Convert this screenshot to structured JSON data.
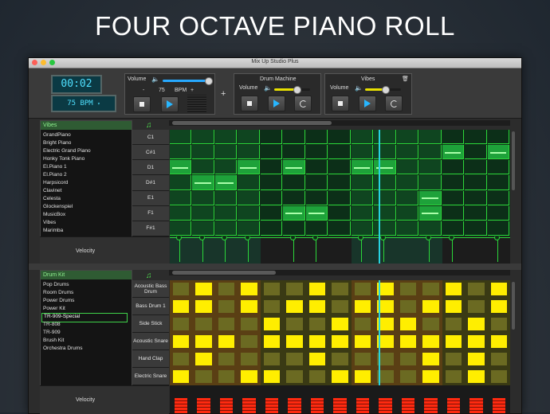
{
  "headline": "FOUR OCTAVE PIANO ROLL",
  "window": {
    "title": "Mix Up Studio Plus"
  },
  "transport": {
    "time": "00:02",
    "tempo": "75 BPM",
    "volume_label": "Volume",
    "volume_level": 0.95,
    "bpm_value": "75",
    "bpm_unit": "BPM",
    "minus": "-",
    "plus": "+"
  },
  "add_track": "+",
  "tracks": [
    {
      "name": "Drum Machine",
      "volume_label": "Volume",
      "volume_level": 0.62
    },
    {
      "name": "Vibes",
      "volume_label": "Volume",
      "volume_level": 0.55
    }
  ],
  "piano": {
    "instrument": "Vibes",
    "instruments": [
      "GrandPiano",
      "Bright Piano",
      "Electric Grand Piano",
      "Honky Tonk Piano",
      "El.Piano 1",
      "El.Piano 2",
      "Harpsicord",
      "Clavinet",
      "Celesta",
      "Glockenspiel",
      "MusicBox",
      "Vibes",
      "Marimba"
    ],
    "notes": [
      "C1",
      "C#1",
      "D1",
      "D#1",
      "E1",
      "F1",
      "F#1"
    ],
    "velocity_label": "Velocity",
    "grid_cells": [
      [
        0,
        0,
        0,
        0,
        0,
        0,
        0,
        0,
        0,
        0,
        0,
        0,
        0,
        0,
        0
      ],
      [
        0,
        0,
        0,
        0,
        0,
        0,
        0,
        0,
        0,
        0,
        0,
        0,
        1,
        0,
        1
      ],
      [
        1,
        0,
        0,
        1,
        0,
        1,
        0,
        0,
        1,
        1,
        0,
        0,
        0,
        0,
        0
      ],
      [
        0,
        1,
        1,
        0,
        0,
        0,
        0,
        0,
        0,
        0,
        0,
        0,
        0,
        0,
        0
      ],
      [
        0,
        0,
        0,
        0,
        0,
        0,
        0,
        0,
        0,
        0,
        0,
        1,
        0,
        0,
        0
      ],
      [
        0,
        0,
        0,
        0,
        0,
        1,
        1,
        0,
        0,
        0,
        0,
        1,
        0,
        0,
        0
      ],
      [
        0,
        0,
        0,
        0,
        0,
        0,
        0,
        0,
        0,
        0,
        0,
        0,
        0,
        0,
        0
      ]
    ],
    "playhead_step": 9.2
  },
  "drums": {
    "kit": "Drum Kit",
    "kits": [
      "Pop Drums",
      "Room Drums",
      "Power Drums",
      "Power Kit",
      "TR-909-Special",
      "TR-808",
      "TR-909",
      "Brush Kit",
      "Orchestra Drums"
    ],
    "selected": "TR-909-Special",
    "voices": [
      "Acoustic Bass Drum",
      "Bass Drum 1",
      "Side Stick",
      "Acoustic Snare",
      "Hand Clap",
      "Electric Snare"
    ],
    "velocity_label": "Velocity",
    "grid_cells": [
      [
        0,
        1,
        0,
        1,
        0,
        0,
        1,
        0,
        0,
        1,
        0,
        0,
        1,
        0,
        1
      ],
      [
        1,
        1,
        0,
        1,
        0,
        1,
        1,
        0,
        1,
        1,
        0,
        1,
        1,
        0,
        1
      ],
      [
        0,
        0,
        0,
        0,
        1,
        0,
        0,
        1,
        0,
        1,
        1,
        0,
        0,
        1,
        0
      ],
      [
        1,
        1,
        1,
        0,
        1,
        1,
        1,
        1,
        1,
        1,
        1,
        1,
        1,
        1,
        1
      ],
      [
        0,
        1,
        0,
        0,
        0,
        0,
        1,
        0,
        0,
        0,
        0,
        1,
        0,
        1,
        0
      ],
      [
        1,
        0,
        0,
        1,
        1,
        0,
        0,
        1,
        1,
        0,
        0,
        1,
        0,
        1,
        0
      ]
    ]
  },
  "colors": {
    "green": "#2bd73a",
    "cyan": "#27d3e0",
    "yellow": "#ffee00",
    "red": "#ff2a10"
  }
}
